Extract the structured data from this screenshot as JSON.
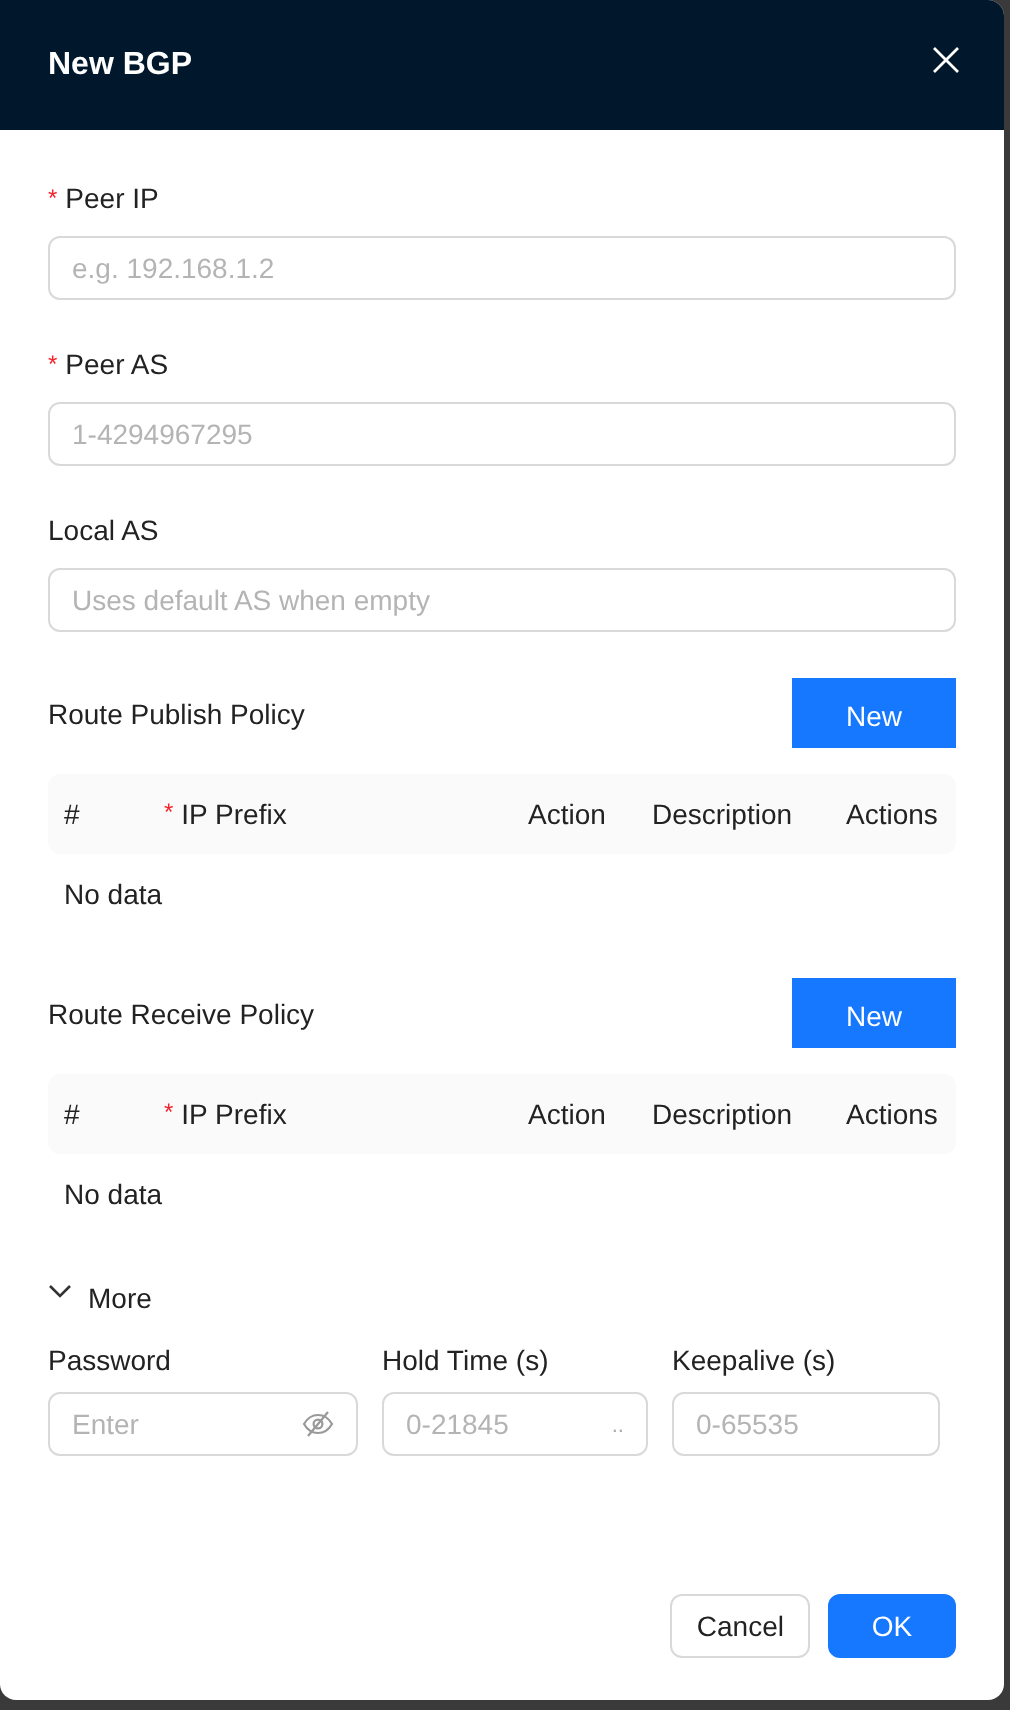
{
  "dialog": {
    "title": "New BGP"
  },
  "fields": [
    {
      "label": "Peer IP",
      "required_mark": "*",
      "placeholder": "e.g. 192.168.1.2"
    },
    {
      "label": "Peer AS",
      "required_mark": "*",
      "placeholder": "1-4294967295"
    },
    {
      "label": "Local AS",
      "placeholder": "Uses default AS when empty"
    }
  ],
  "policies": [
    {
      "title": "Route Publish Policy",
      "button": "New",
      "columns": [
        {
          "label": "#"
        },
        {
          "label": "IP Prefix",
          "required_mark": "*"
        },
        {
          "label": "Action"
        },
        {
          "label": "Description"
        },
        {
          "label": "Actions"
        }
      ],
      "empty_text": "No data"
    },
    {
      "title": "Route Receive Policy",
      "button": "New",
      "columns": [
        {
          "label": "#"
        },
        {
          "label": "IP Prefix",
          "required_mark": "*"
        },
        {
          "label": "Action"
        },
        {
          "label": "Description"
        },
        {
          "label": "Actions"
        }
      ],
      "empty_text": "No data"
    }
  ],
  "more": {
    "label": "More",
    "expanded": true,
    "fields": [
      {
        "kind": "password",
        "label": "Password",
        "placeholder": "Enter"
      },
      {
        "kind": "number",
        "label": "Hold Time (s)",
        "placeholder": "0-21845",
        "suffix": ".."
      },
      {
        "kind": "text",
        "label": "Keepalive (s)",
        "placeholder": "0-65535"
      }
    ]
  },
  "buttons": [
    {
      "label": "Cancel",
      "kind": "default"
    },
    {
      "label": "OK",
      "kind": "primary"
    }
  ]
}
